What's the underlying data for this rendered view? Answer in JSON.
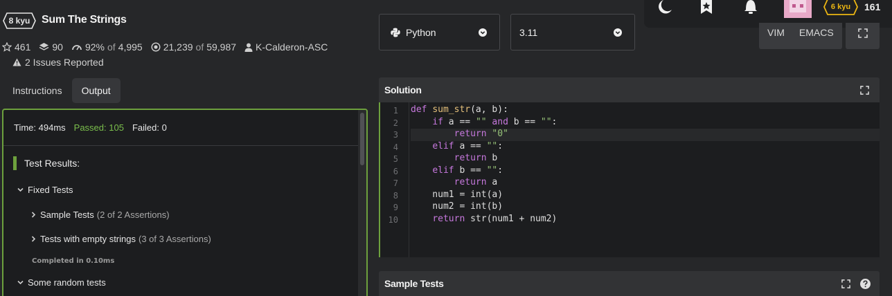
{
  "kata": {
    "rank": "8 kyu",
    "title": "Sum The Strings",
    "stars": "461",
    "collections": "90",
    "satisfaction": "92%",
    "satisfaction_of_label": "of",
    "votes": "4,995",
    "completed": "21,239",
    "completed_of_label": "of",
    "attempts": "59,987",
    "author": "K-Calderon-ASC",
    "issues": "2 Issues Reported"
  },
  "tabs": [
    {
      "label": "Instructions"
    },
    {
      "label": "Output"
    }
  ],
  "output": {
    "time": "Time: 494ms",
    "passed": "Passed: 105",
    "failed": "Failed: 0",
    "results_title": "Test Results:",
    "groups": [
      {
        "label": "Fixed Tests"
      },
      {
        "label": "Sample Tests",
        "assertions": "(2 of 2 Assertions)"
      },
      {
        "label": "Tests with empty strings",
        "assertions": "(3 of 3 Assertions)"
      },
      {
        "completed": "Completed in 0.10ms"
      },
      {
        "label": "Some random tests"
      }
    ]
  },
  "language_select": {
    "value": "Python"
  },
  "version_select": {
    "value": "3.11"
  },
  "editor_modes": {
    "vim": "VIM",
    "emacs": "EMACS"
  },
  "user": {
    "rank": "6 kyu",
    "honor": "161"
  },
  "solution": {
    "title": "Solution",
    "line_numbers": [
      "1",
      "2",
      "3",
      "4",
      "5",
      "6",
      "7",
      "8",
      "9",
      "10"
    ]
  },
  "sample_tests": {
    "title": "Sample Tests"
  },
  "icons": {
    "theme": "moon-icon",
    "bookmark": "bookmark-star-icon",
    "notifications": "bell-icon",
    "fullscreen": "expand-icon",
    "help": "question-icon"
  },
  "colors": {
    "accent_green": "#6da13d",
    "passed_green": "#7bbf4c",
    "rank_yellow": "#ecb613",
    "keyword": "#c678dd",
    "function": "#e5c07b",
    "string": "#98c379"
  }
}
